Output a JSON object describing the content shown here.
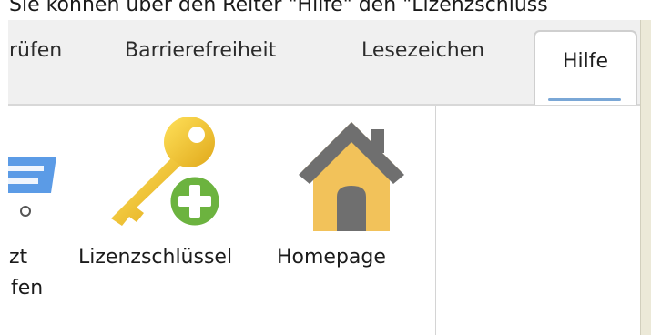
{
  "caption": "Sie können über den Reiter \"Hilfe\" den \"Lizenzschlüss",
  "tabs": [
    {
      "label": "prüfen"
    },
    {
      "label": "Barrierefreiheit"
    },
    {
      "label": "Lesezeichen"
    },
    {
      "label": "Hilfe",
      "active": true
    }
  ],
  "buttons": {
    "partial_line1": "zt",
    "partial_line2": "fen",
    "license": "Lizenzschlüssel",
    "homepage": "Homepage"
  },
  "icons": {
    "partial": "cart-icon",
    "license": "key-add-icon",
    "homepage": "home-icon"
  },
  "colors": {
    "tab_underline": "#7aa7d6",
    "key": "#f2c62f",
    "plus_badge": "#6cb33f",
    "house_roof": "#6f6f6f",
    "house_wall": "#f2c25a",
    "cart": "#4a90e2"
  }
}
